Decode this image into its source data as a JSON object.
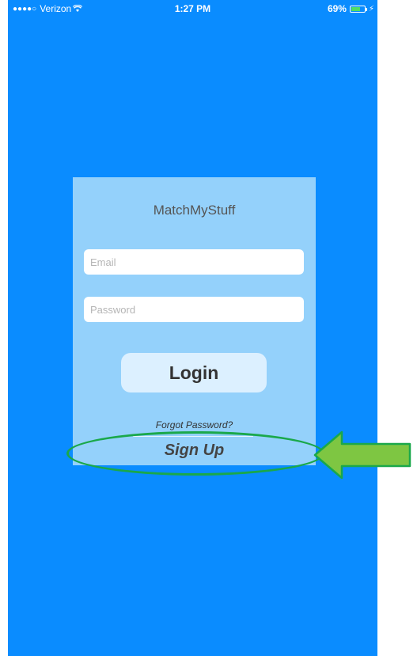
{
  "status_bar": {
    "signal_dots": "●●●●○",
    "carrier": "Verizon",
    "wifi_icon": "wifi-icon",
    "time": "1:27 PM",
    "battery_percent": "69%",
    "battery_level": 0.69,
    "battery_color": "#4ede63",
    "charging_icon": "⚡"
  },
  "login_card": {
    "app_title": "MatchMyStuff",
    "email": {
      "placeholder": "Email",
      "value": ""
    },
    "password": {
      "placeholder": "Password",
      "value": ""
    },
    "login_label": "Login",
    "forgot_password_label": "Forgot Password?",
    "signup_label": "Sign Up"
  },
  "annotation": {
    "highlight_color": "#1aa84a",
    "arrow_color": "#7ec642"
  },
  "colors": {
    "background": "#0a8cff",
    "card": "#94d1fb",
    "login_button": "#dcf0ff"
  }
}
